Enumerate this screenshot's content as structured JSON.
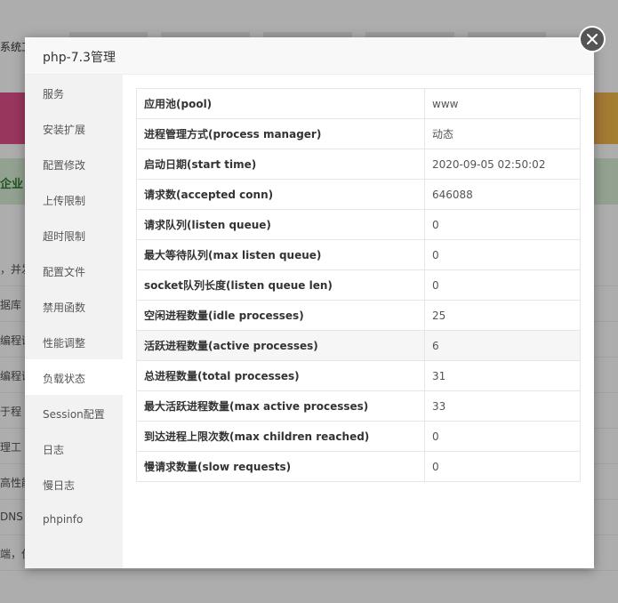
{
  "background": {
    "tab_label": "系统工",
    "green_label": "企业",
    "rows": [
      "，并发",
      "据库",
      "编程语",
      "编程语",
      "于程",
      "理工",
      "高性能",
      "DNS",
      "端，仅"
    ]
  },
  "dialog": {
    "title": "php-7.3管理",
    "sidebar": [
      {
        "label": "服务"
      },
      {
        "label": "安装扩展"
      },
      {
        "label": "配置修改"
      },
      {
        "label": "上传限制"
      },
      {
        "label": "超时限制"
      },
      {
        "label": "配置文件"
      },
      {
        "label": "禁用函数"
      },
      {
        "label": "性能调整"
      },
      {
        "label": "负载状态"
      },
      {
        "label": "Session配置"
      },
      {
        "label": "日志"
      },
      {
        "label": "慢日志"
      },
      {
        "label": "phpinfo"
      }
    ],
    "active_item": "负载状态",
    "status_rows": [
      {
        "key": "应用池(pool)",
        "value": "www"
      },
      {
        "key": "进程管理方式(process manager)",
        "value": "动态"
      },
      {
        "key": "启动日期(start time)",
        "value": "2020-09-05 02:50:02"
      },
      {
        "key": "请求数(accepted conn)",
        "value": "646088"
      },
      {
        "key": "请求队列(listen queue)",
        "value": "0"
      },
      {
        "key": "最大等待队列(max listen queue)",
        "value": "0"
      },
      {
        "key": "socket队列长度(listen queue len)",
        "value": "0"
      },
      {
        "key": "空闲进程数量(idle processes)",
        "value": "25"
      },
      {
        "key": "活跃进程数量(active processes)",
        "value": "6"
      },
      {
        "key": "总进程数量(total processes)",
        "value": "31"
      },
      {
        "key": "最大活跃进程数量(max active processes)",
        "value": "33"
      },
      {
        "key": "到达进程上限次数(max children reached)",
        "value": "0"
      },
      {
        "key": "慢请求数量(slow requests)",
        "value": "0"
      }
    ],
    "close_icon": "close-icon"
  }
}
